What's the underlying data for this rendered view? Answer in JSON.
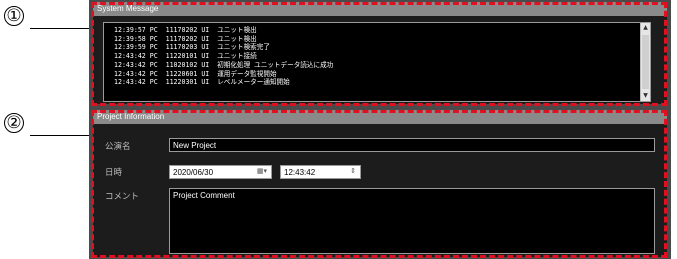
{
  "callouts": {
    "one": "①",
    "two": "②"
  },
  "system_message": {
    "header": "System Message",
    "lines": [
      "12:39:57 PC  11170202 UI  ユニット検出",
      "12:39:58 PC  11170202 UI  ユニット検出",
      "12:39:59 PC  11170203 UI  ユニット検索完了",
      "12:43:42 PC  11220101 UI  ユニット接続",
      "12:43:42 PC  11020102 UI  初期化処理 ユニットデータ読込に成功",
      "12:43:42 PC  11220601 UI  運用データ監視開始",
      "12:43:42 PC  11220301 UI  レベルメーター通知開始"
    ]
  },
  "project_information": {
    "header": "Project Information",
    "performance_name_label": "公演名",
    "performance_name_value": "New Project",
    "datetime_label": "日時",
    "date_value": "2020/06/30",
    "time_value": "12:43:42",
    "comment_label": "コメント",
    "comment_value": "Project Comment"
  },
  "colors": {
    "highlight": "#e01020",
    "panel": "#1c1c1c",
    "header": "#8a8a8a"
  },
  "icons": {
    "calendar": "calendar-dropdown-icon",
    "spinner": "time-spinner-icon"
  }
}
